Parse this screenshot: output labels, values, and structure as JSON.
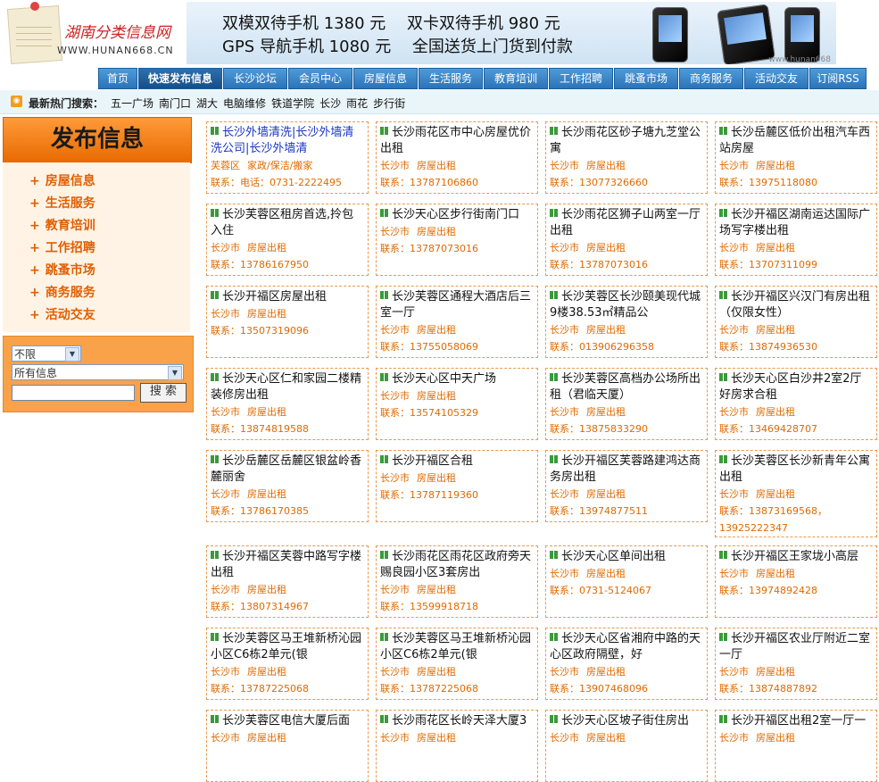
{
  "site": {
    "logo_title": "湖南分类信息网",
    "logo_url": "WWW.HUNAN668.CN"
  },
  "banner": {
    "line1": "双模双待手机 1380 元　 双卡双待手机 980 元",
    "line2": "GPS 导航手机 1080 元　 全国送货上门货到付款",
    "small": "www.hunan668"
  },
  "nav": [
    {
      "label": "首页"
    },
    {
      "label": "快速发布信息",
      "active": true
    },
    {
      "label": "长沙论坛"
    },
    {
      "label": "会员中心"
    },
    {
      "label": "房屋信息"
    },
    {
      "label": "生活服务"
    },
    {
      "label": "教育培训"
    },
    {
      "label": "工作招聘"
    },
    {
      "label": "跳蚤市场"
    },
    {
      "label": "商务服务"
    },
    {
      "label": "活动交友"
    },
    {
      "label": "订阅RSS"
    }
  ],
  "hot": {
    "label": "最新热门搜索：",
    "keywords": [
      "五一广场",
      "南门口",
      "湖大",
      "电脑维修",
      "铁道学院",
      "长沙",
      "雨花",
      "步行街"
    ]
  },
  "sidebar": {
    "publish": "发布信息",
    "categories": [
      "房屋信息",
      "生活服务",
      "教育培训",
      "工作招聘",
      "跳蚤市场",
      "商务服务",
      "活动交友"
    ],
    "search": {
      "range": "不限",
      "type": "所有信息",
      "keyword": "",
      "button": "搜 索"
    }
  },
  "listings": [
    {
      "title": "长沙外墙清洗|长沙外墙清洗公司|长沙外墙清",
      "blue": true,
      "area": "芙蓉区",
      "cat": "家政/保洁/搬家",
      "contact": "联系：电话：0731-2222495"
    },
    {
      "title": "长沙雨花区市中心房屋优价出租",
      "area": "长沙市",
      "cat": "房屋出租",
      "contact": "联系：13787106860"
    },
    {
      "title": "长沙雨花区砂子塘九芝堂公寓",
      "area": "长沙市",
      "cat": "房屋出租",
      "contact": "联系：13077326660"
    },
    {
      "title": "长沙岳麓区低价出租汽车西站房屋",
      "area": "长沙市",
      "cat": "房屋出租",
      "contact": "联系：13975118080"
    },
    {
      "title": "长沙芙蓉区租房首选,拎包入住",
      "area": "长沙市",
      "cat": "房屋出租",
      "contact": "联系：13786167950"
    },
    {
      "title": "长沙天心区步行街南门口",
      "area": "长沙市",
      "cat": "房屋出租",
      "contact": "联系：13787073016"
    },
    {
      "title": "长沙雨花区狮子山两室一厅出租",
      "area": "长沙市",
      "cat": "房屋出租",
      "contact": "联系：13787073016"
    },
    {
      "title": "长沙开福区湖南运达国际广场写字楼出租",
      "area": "长沙市",
      "cat": "房屋出租",
      "contact": "联系：13707311099"
    },
    {
      "title": "长沙开福区房屋出租",
      "area": "长沙市",
      "cat": "房屋出租",
      "contact": "联系：13507319096"
    },
    {
      "title": "长沙芙蓉区通程大酒店后三室一厅",
      "area": "长沙市",
      "cat": "房屋出租",
      "contact": "联系：13755058069"
    },
    {
      "title": "长沙芙蓉区长沙颐美现代城9楼38.53㎡精品公",
      "area": "长沙市",
      "cat": "房屋出租",
      "contact": "联系：013906296358"
    },
    {
      "title": "长沙开福区兴汉门有房出租（仅限女性）",
      "area": "长沙市",
      "cat": "房屋出租",
      "contact": "联系：13874936530"
    },
    {
      "title": "长沙天心区仁和家园二楼精装修房出租",
      "area": "长沙市",
      "cat": "房屋出租",
      "contact": "联系：13874819588"
    },
    {
      "title": "长沙天心区中天广场",
      "area": "长沙市",
      "cat": "房屋出租",
      "contact": "联系：13574105329"
    },
    {
      "title": "长沙芙蓉区高档办公场所出租（君临天厦）",
      "area": "长沙市",
      "cat": "房屋出租",
      "contact": "联系：13875833290"
    },
    {
      "title": "长沙天心区白沙井2室2厅好房求合租",
      "area": "长沙市",
      "cat": "房屋出租",
      "contact": "联系：13469428707"
    },
    {
      "title": "长沙岳麓区岳麓区银盆岭香麓丽舍",
      "area": "长沙市",
      "cat": "房屋出租",
      "contact": "联系：13786170385"
    },
    {
      "title": "长沙开福区合租",
      "area": "长沙市",
      "cat": "房屋出租",
      "contact": "联系：13787119360"
    },
    {
      "title": "长沙开福区芙蓉路建鸿达商务房出租",
      "area": "长沙市",
      "cat": "房屋出租",
      "contact": "联系：13974877511"
    },
    {
      "title": "长沙芙蓉区长沙新青年公寓出租",
      "area": "长沙市",
      "cat": "房屋出租",
      "contact": "联系：13873169568，13925222347"
    },
    {
      "title": "长沙开福区芙蓉中路写字楼出租",
      "area": "长沙市",
      "cat": "房屋出租",
      "contact": "联系：13807314967"
    },
    {
      "title": "长沙雨花区雨花区政府旁天赐良园小区3套房出",
      "area": "长沙市",
      "cat": "房屋出租",
      "contact": "联系：13599918718"
    },
    {
      "title": "长沙天心区单间出租",
      "area": "长沙市",
      "cat": "房屋出租",
      "contact": "联系：0731-5124067"
    },
    {
      "title": "长沙开福区王家垅小高层",
      "area": "长沙市",
      "cat": "房屋出租",
      "contact": "联系：13974892428"
    },
    {
      "title": "长沙芙蓉区马王堆新桥沁园小区C6栋2单元(银",
      "area": "长沙市",
      "cat": "房屋出租",
      "contact": "联系：13787225068"
    },
    {
      "title": "长沙芙蓉区马王堆新桥沁园小区C6栋2单元(银",
      "area": "长沙市",
      "cat": "房屋出租",
      "contact": "联系：13787225068"
    },
    {
      "title": "长沙天心区省湘府中路的天心区政府隔壁，好",
      "area": "长沙市",
      "cat": "房屋出租",
      "contact": "联系：13907468096"
    },
    {
      "title": "长沙开福区农业厅附近二室一厅",
      "area": "长沙市",
      "cat": "房屋出租",
      "contact": "联系：13874887892"
    },
    {
      "title": "长沙芙蓉区电信大厦后面",
      "area": "长沙市",
      "cat": "房屋出租",
      "contact": ""
    },
    {
      "title": "长沙雨花区长岭天泽大厦3",
      "area": "长沙市",
      "cat": "房屋出租",
      "contact": ""
    },
    {
      "title": "长沙天心区坡子街住房出",
      "area": "长沙市",
      "cat": "房屋出租",
      "contact": ""
    },
    {
      "title": "长沙开福区出租2室一厅一",
      "area": "长沙市",
      "cat": "房屋出租",
      "contact": ""
    }
  ]
}
